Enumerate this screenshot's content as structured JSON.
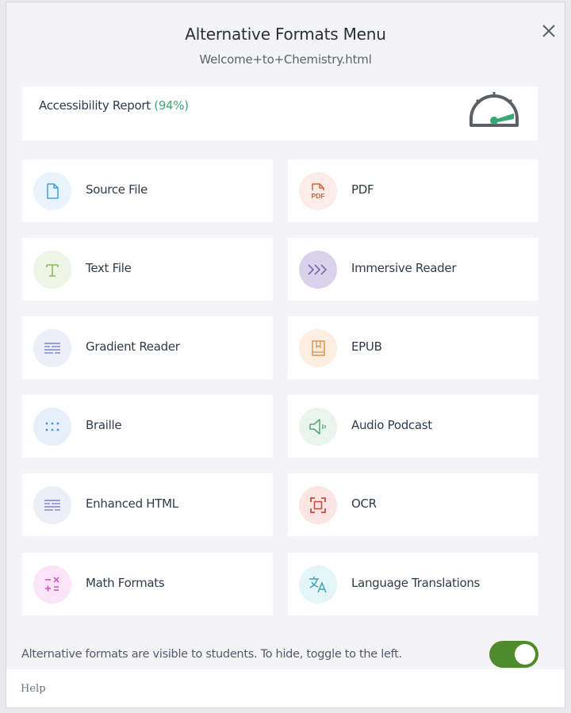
{
  "dialog": {
    "title": "Alternative Formats Menu",
    "subtitle": "Welcome+to+Chemistry.html"
  },
  "report": {
    "label": "Accessibility Report",
    "percent": "(94%)",
    "score_fraction": 0.94,
    "icon": "speedometer-icon"
  },
  "formats": [
    {
      "label": "Source File",
      "icon": "file-icon",
      "color": "#4aa3e6",
      "bg": "#e8f3fc"
    },
    {
      "label": "PDF",
      "icon": "pdf-icon",
      "color": "#d8603f",
      "bg": "#fcece7"
    },
    {
      "label": "Text File",
      "icon": "text-t-icon",
      "color": "#8cb85c",
      "bg": "#eef5e6"
    },
    {
      "label": "Immersive Reader",
      "icon": "chevrons-right-icon",
      "color": "#7b68b0",
      "bg": "#d9d2ec"
    },
    {
      "label": "Gradient Reader",
      "icon": "gradient-lines-icon",
      "color": "#7b84c8",
      "bg": "#eceef8"
    },
    {
      "label": "EPUB",
      "icon": "book-icon",
      "color": "#d99a5b",
      "bg": "#fcefe2"
    },
    {
      "label": "Braille",
      "icon": "braille-dots-icon",
      "color": "#4d8ed8",
      "bg": "#e6f0fb"
    },
    {
      "label": "Audio Podcast",
      "icon": "speaker-icon",
      "color": "#5aa377",
      "bg": "#e8f4ec"
    },
    {
      "label": "Enhanced HTML",
      "icon": "enhanced-lines-icon",
      "color": "#7b84c8",
      "bg": "#eceef8"
    },
    {
      "label": "OCR",
      "icon": "scan-icon",
      "color": "#d0493f",
      "bg": "#fbe6e4"
    },
    {
      "label": "Math Formats",
      "icon": "math-symbols-icon",
      "color": "#d14bc9",
      "bg": "#fbe3f8"
    },
    {
      "label": "Language Translations",
      "icon": "translate-icon",
      "color": "#3a9fb3",
      "bg": "#e3f5f8"
    }
  ],
  "footer": {
    "note": "Alternative formats are visible to students. To hide, toggle to the left.",
    "toggle_on": true,
    "help": "Help"
  },
  "colors": {
    "accent_green": "#3aa776",
    "toggle_green": "#4f8a2c",
    "gauge_gray": "#5c5f63"
  }
}
